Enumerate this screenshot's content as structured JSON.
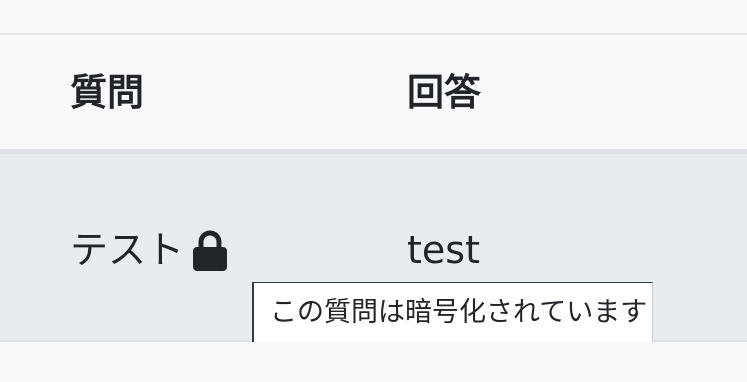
{
  "table": {
    "headers": {
      "question": "質問",
      "answer": "回答"
    },
    "rows": [
      {
        "question": "テスト",
        "question_icon": "lock-icon",
        "answer": "test"
      }
    ]
  },
  "tooltip": {
    "text": "この質問は暗号化されています"
  },
  "colors": {
    "background": "#f8f9fa",
    "row_background": "#e9ecef",
    "text": "#212529",
    "border": "#dee2e6"
  }
}
